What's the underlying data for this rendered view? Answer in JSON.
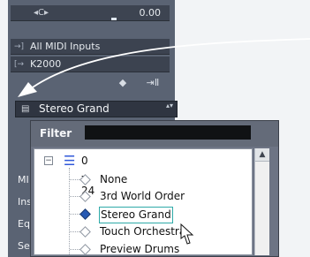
{
  "top_bar": {
    "pan_label": "◂C▸",
    "value": "0.00"
  },
  "midi": {
    "input_icon": "→]",
    "input": "All MIDI Inputs",
    "output_icon": "[→",
    "output": "K2000"
  },
  "program": {
    "icon": "▤",
    "label": "Stereo Grand",
    "arrows": "▴▾"
  },
  "side_labels": [
    "MI",
    "Ins",
    "Eq",
    "Se"
  ],
  "popup": {
    "filter_label": "Filter",
    "filter_value": "",
    "root_label": "0 - 24",
    "items": [
      {
        "label": "None",
        "selected": false
      },
      {
        "label": "3rd World Order",
        "selected": false
      },
      {
        "label": "Stereo Grand",
        "selected": true
      },
      {
        "label": "Touch Orchestra",
        "selected": false
      },
      {
        "label": "Preview Drums",
        "selected": false
      }
    ]
  },
  "icons": {
    "minus": "−",
    "folder": "☰",
    "scroll_up": "▲",
    "diamond": "◆",
    "keyboard": "⇥Ⅱ"
  }
}
